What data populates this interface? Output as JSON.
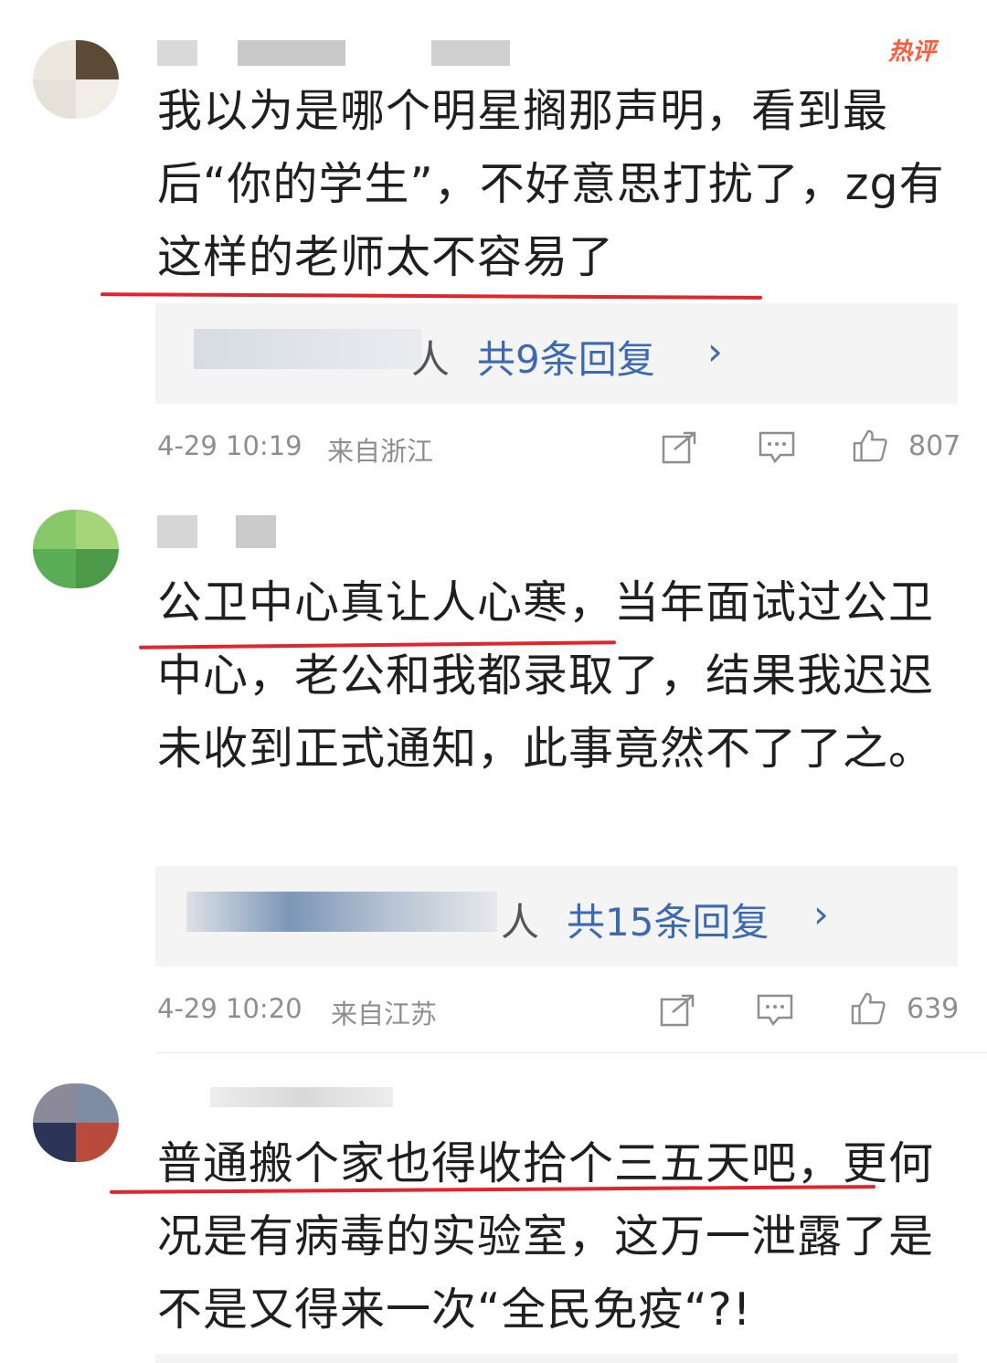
{
  "badge": {
    "hot": "热评"
  },
  "comments": [
    {
      "text": "我以为是哪个明星搁那声明，看到最后“你的学生”，不好意思打扰了，zg有这样的老师太不容易了",
      "replies_author_fragment": "人",
      "replies_label": "共9条回复",
      "chevron": "›",
      "time": "4-29 10:19",
      "location": "来自浙江",
      "likes": "807"
    },
    {
      "text": "公卫中心真让人心寒，当年面试过公卫中心，老公和我都录取了，结果我迟迟未收到正式通知，此事竟然不了了之。",
      "replies_author_fragment": "人",
      "replies_label": "共15条回复",
      "chevron": "›",
      "time": "4-29 10:20",
      "location": "来自江苏",
      "likes": "639"
    },
    {
      "text": "普通搬个家也得收拾个三五天吧，更何况是有病毒的实验室，这万一泄露了是不是又得来一次“全民免疫“?!"
    }
  ],
  "icons": {
    "share": "share-icon",
    "comment": "comment-icon",
    "like": "thumbs-up-icon"
  },
  "colors": {
    "link": "#3b6ab2",
    "underline": "#e0262a",
    "hot": "#ff5a3d",
    "meta": "#8e8e8e"
  }
}
